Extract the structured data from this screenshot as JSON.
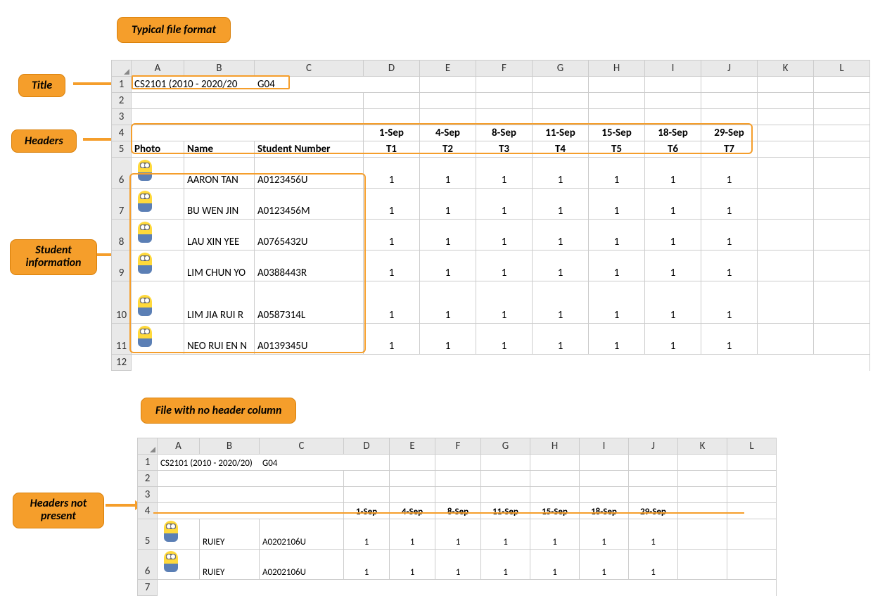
{
  "callouts": {
    "typical": "Typical file format",
    "title": "Title",
    "headers": "Headers",
    "student_info": "Student information",
    "no_header": "File with no header column",
    "headers_not_present": "Headers not present"
  },
  "sheet1": {
    "columns": [
      "A",
      "B",
      "C",
      "D",
      "E",
      "F",
      "G",
      "H",
      "I",
      "J",
      "K",
      "L"
    ],
    "title_a": "CS2101 (2010 - 2020/20",
    "title_b": "G04",
    "dates": [
      "1-Sep",
      "4-Sep",
      "8-Sep",
      "11-Sep",
      "15-Sep",
      "18-Sep",
      "29-Sep"
    ],
    "headers": {
      "photo": "Photo",
      "name": "Name",
      "sn": "Student Number",
      "t": [
        "T1",
        "T2",
        "T3",
        "T4",
        "T5",
        "T6",
        "T7"
      ]
    },
    "rows": [
      {
        "name": "AARON TAN",
        "sn": "A0123456U",
        "v": [
          "1",
          "1",
          "1",
          "1",
          "1",
          "1",
          "1"
        ]
      },
      {
        "name": "BU WEN JIN",
        "sn": "A0123456M",
        "v": [
          "1",
          "1",
          "1",
          "1",
          "1",
          "1",
          "1"
        ]
      },
      {
        "name": "LAU XIN YEE",
        "sn": "A0765432U",
        "v": [
          "1",
          "1",
          "1",
          "1",
          "1",
          "1",
          "1"
        ]
      },
      {
        "name": "LIM CHUN YO",
        "sn": "A0388443R",
        "v": [
          "1",
          "1",
          "1",
          "1",
          "1",
          "1",
          "1"
        ]
      },
      {
        "name": "LIM JIA RUI R",
        "sn": "A0587314L",
        "v": [
          "1",
          "1",
          "1",
          "1",
          "1",
          "1",
          "1"
        ]
      },
      {
        "name": "NEO RUI EN N",
        "sn": "A0139345U",
        "v": [
          "1",
          "1",
          "1",
          "1",
          "1",
          "1",
          "1"
        ]
      }
    ]
  },
  "sheet2": {
    "columns": [
      "A",
      "B",
      "C",
      "D",
      "E",
      "F",
      "G",
      "H",
      "I",
      "J",
      "K",
      "L"
    ],
    "title_a": "CS2101 (2010 - 2020/20)",
    "title_b": "G04",
    "dates": [
      "1-Sep",
      "4-Sep",
      "8-Sep",
      "11-Sep",
      "15-Sep",
      "18-Sep",
      "29-Sep"
    ],
    "rows": [
      {
        "name": "RUIEY",
        "sn": "A0202106U",
        "v": [
          "1",
          "1",
          "1",
          "1",
          "1",
          "1",
          "1"
        ]
      },
      {
        "name": "RUIEY",
        "sn": "A0202106U",
        "v": [
          "1",
          "1",
          "1",
          "1",
          "1",
          "1",
          "1"
        ]
      }
    ]
  }
}
